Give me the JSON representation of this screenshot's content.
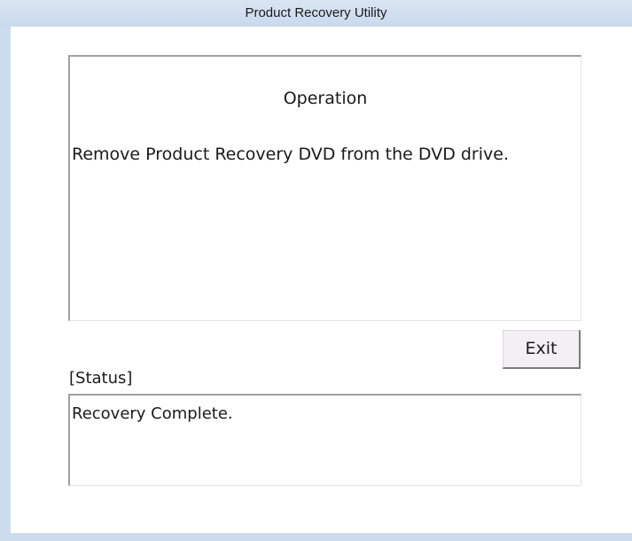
{
  "window": {
    "title": "Product Recovery Utility"
  },
  "operation": {
    "heading": "Operation",
    "message": "Remove Product Recovery DVD from the DVD drive."
  },
  "buttons": {
    "exit_label": "Exit"
  },
  "status": {
    "label": "[Status]",
    "text": "Recovery Complete."
  },
  "colors": {
    "frame": "#cddcec",
    "client_background": "#ffffff",
    "button_face": "#f3f0f3"
  }
}
